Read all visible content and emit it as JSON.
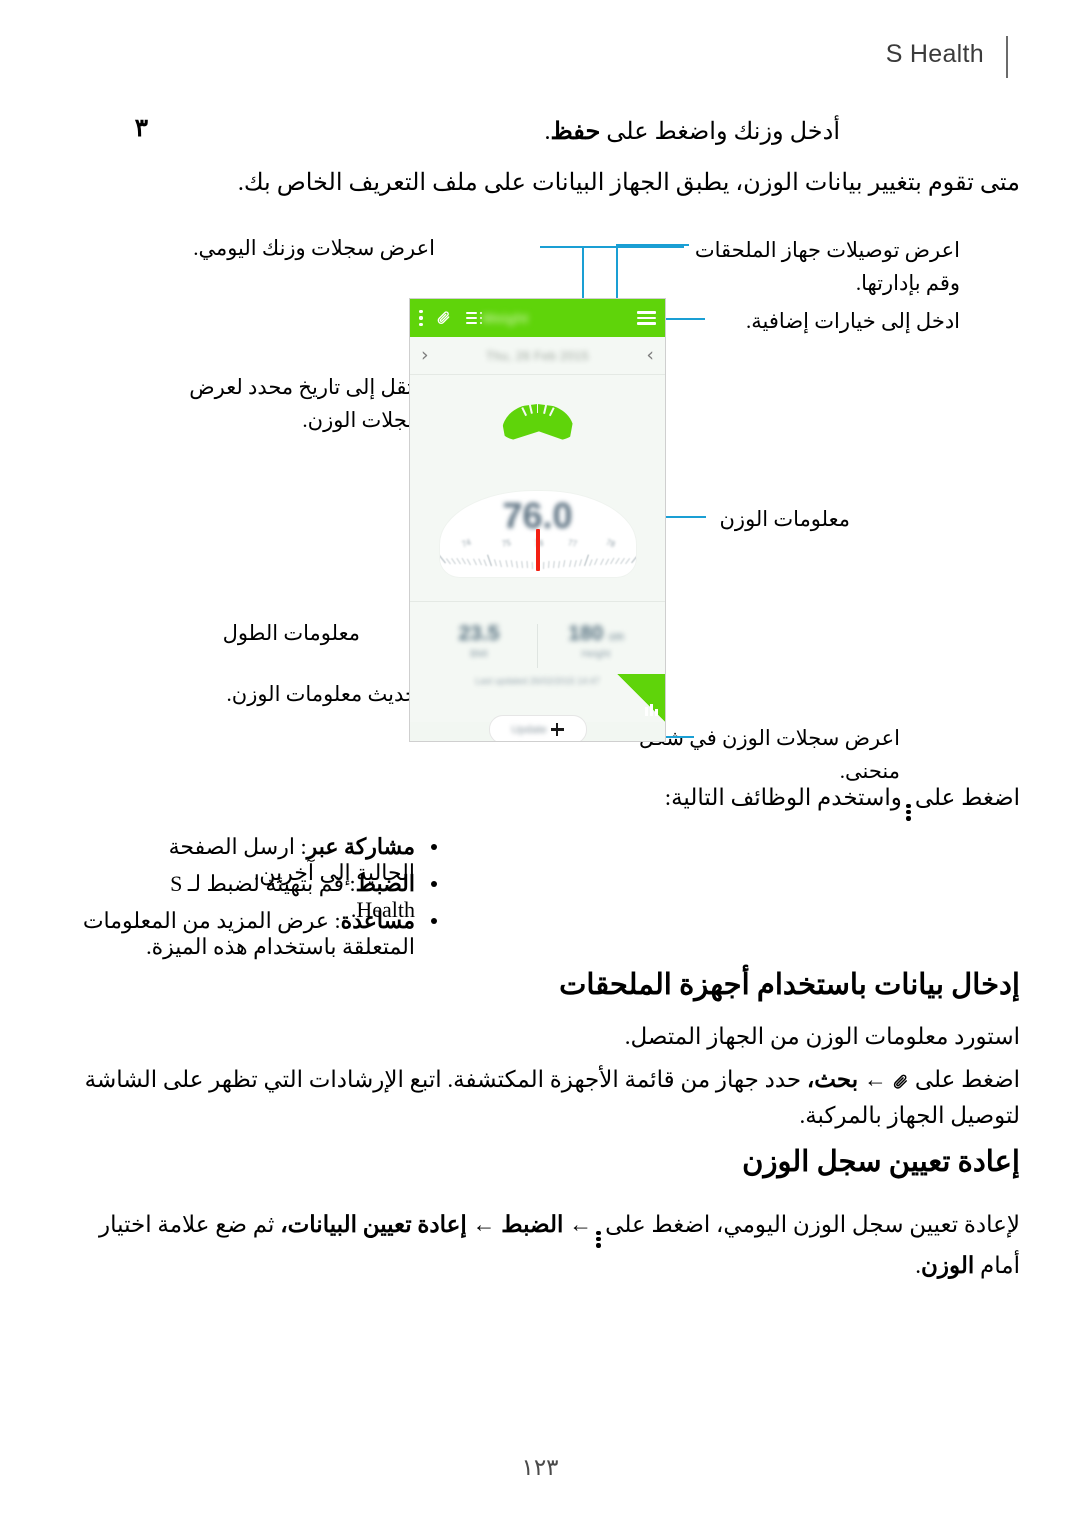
{
  "running_head": {
    "title": "S Health"
  },
  "step": {
    "number": "٣",
    "text_plain": "أدخل وزنك واضغط على ",
    "text_bold": "حفظ",
    "text_tail": "."
  },
  "intro_paragraph": "متى تقوم بتغيير بيانات الوزن، يطبق الجهاز البيانات على ملف التعريف الخاص بك.",
  "callouts": {
    "left": [
      {
        "id": "daily-records",
        "text": "اعرض سجلات وزنك اليومي."
      },
      {
        "id": "date-navigate",
        "text": "انتقل إلى تاريخ محدد لعرض سجلات الوزن."
      },
      {
        "id": "height-info",
        "text": "معلومات الطول"
      },
      {
        "id": "update-weight",
        "text": "قم بتحديث معلومات الوزن."
      }
    ],
    "right": [
      {
        "id": "accessory-connections",
        "text": "اعرض توصيلات جهاز الملحقات وقم بإدارتها."
      },
      {
        "id": "more-options",
        "text": "ادخل إلى خيارات إضافية."
      },
      {
        "id": "weight-info",
        "text": "معلومات الوزن"
      },
      {
        "id": "curve-chart",
        "text": "اعرض سجلات الوزن في شكل منحنى."
      }
    ]
  },
  "phone": {
    "app_title": "Weight",
    "date_label": "Thu, 26 Feb 2015",
    "weight_value": "76.0",
    "scale_numbers": [
      "74",
      "75",
      "76",
      "77",
      "78"
    ],
    "height": {
      "value": "180",
      "unit": "cm",
      "label": "Height"
    },
    "bmi": {
      "value": "23.5",
      "label": "BMI"
    },
    "last_updated": "Last updated 26/02/2015 14:47",
    "update_button": "Update",
    "icons": {
      "menu": "hamburger-icon",
      "list": "list-icon",
      "clip": "paperclip-icon",
      "more": "more-vertical-icon",
      "prev": "‹",
      "next": "›",
      "chart": "bar-chart-icon"
    }
  },
  "functions_intro": {
    "before": "اضغط على",
    "after": "واستخدم الوظائف التالية:"
  },
  "function_bullets": [
    {
      "label": "مشاركة عبر",
      "desc": ": ارسل الصفحة الحالية إلى آخرين."
    },
    {
      "label": "الضبط",
      "desc": ": قم بتهيئة لضبط لـ S Health."
    },
    {
      "label": "مساعدة",
      "desc": ": عرض المزيد من المعلومات المتعلقة باستخدام هذه الميزة."
    }
  ],
  "section_accessories": {
    "heading": "إدخال بيانات باستخدام أجهزة الملحقات",
    "paragraph": "استورد معلومات الوزن من الجهاز المتصل.",
    "instruction_parts": {
      "p1": "اضغط على",
      "p2": "←",
      "p3": "بحث،",
      "p4": "حدد جهاز من قائمة الأجهزة المكتشفة. اتبع الإرشادات التي تظهر على الشاشة لتوصيل الجهاز بالمركبة."
    }
  },
  "section_reset": {
    "heading": "إعادة تعيين سجل الوزن",
    "instruction_parts": {
      "p1": "لإعادة تعيين سجل الوزن اليومي، اضغط على",
      "p2": "←",
      "p3": "الضبط",
      "p4": "←",
      "p5": "إعادة تعيين البيانات،",
      "p6": "ثم ضع علامة اختيار أمام",
      "p7": "الوزن",
      "p8": "."
    }
  },
  "page_number": "١٢٣",
  "colors": {
    "brand_green": "#5fd40a",
    "callout_blue": "#1a9fd4",
    "needle_red": "#f32013"
  }
}
